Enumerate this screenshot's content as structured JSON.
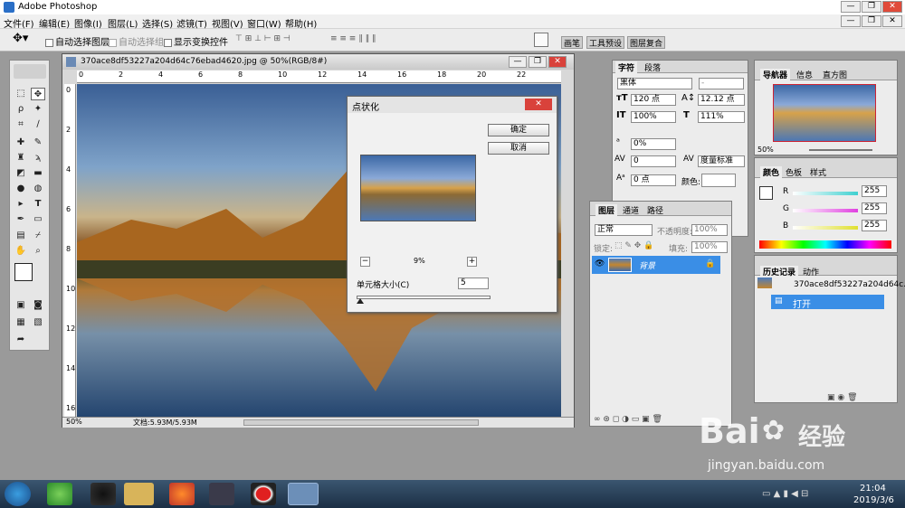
{
  "app": {
    "title": "Adobe Photoshop"
  },
  "window_controls": {
    "min": "—",
    "max": "❐",
    "close": "✕"
  },
  "menu": [
    "文件(F)",
    "编辑(E)",
    "图像(I)",
    "图层(L)",
    "选择(S)",
    "滤镜(T)",
    "视图(V)",
    "窗口(W)",
    "帮助(H)"
  ],
  "options_bar": {
    "auto_select_layer": "自动选择图层",
    "auto_select_group": "自动选择组",
    "show_transform": "显示变换控件",
    "panel_tabs": [
      "画笔",
      "工具预设",
      "图层复合"
    ]
  },
  "document": {
    "title": "370ace8df53227a204d64c76ebad4620.jpg @ 50%(RGB/8#)",
    "zoom": "50%",
    "file_info": "文档:5.93M/5.93M",
    "ruler_h": [
      "0",
      "2",
      "4",
      "6",
      "8",
      "10",
      "12",
      "14",
      "16",
      "18",
      "20",
      "22"
    ],
    "ruler_v": [
      "0",
      "2",
      "4",
      "6",
      "8",
      "10",
      "12",
      "14",
      "16"
    ]
  },
  "dialog": {
    "title": "点状化",
    "ok": "确定",
    "cancel": "取消",
    "zoom": "9%",
    "minus": "−",
    "plus": "+",
    "cell_size_label": "单元格大小(C)",
    "cell_size_value": "5"
  },
  "char_panel": {
    "tabs": [
      "字符",
      "段落"
    ],
    "font": "黑体",
    "style": "-",
    "size": "120 点",
    "leading": "12.12 点",
    "vscale": "100%",
    "hscale": "111%",
    "tracking_pct": "0%",
    "kerning": "0",
    "tracking_mode": "度量标准",
    "baseline": "0 点",
    "color_label": "颜色:"
  },
  "layers_panel": {
    "tabs": [
      "图层",
      "通道",
      "路径"
    ],
    "blend": "正常",
    "opacity_label": "不透明度:",
    "opacity": "100%",
    "lock_label": "锁定:",
    "fill_label": "填充:",
    "fill": "100%",
    "layer_name": "背景"
  },
  "navigator_panel": {
    "tabs": [
      "导航器",
      "信息",
      "直方图"
    ],
    "zoom": "50%"
  },
  "color_panel": {
    "tabs": [
      "颜色",
      "色板",
      "样式"
    ],
    "channels": [
      {
        "name": "R",
        "value": "255",
        "color": "#3fd0d0"
      },
      {
        "name": "G",
        "value": "255",
        "color": "#e040e0"
      },
      {
        "name": "B",
        "value": "255",
        "color": "#e0e030"
      }
    ]
  },
  "history_panel": {
    "tabs": [
      "历史记录",
      "动作"
    ],
    "snapshot": "370ace8df53227a204d64c...",
    "step": "打开"
  },
  "taskbar": {
    "time": "21:04",
    "date": "2019/3/6"
  },
  "watermark": {
    "brand": "Bai",
    "brand2": "经验",
    "url": "jingyan.baidu.com"
  }
}
